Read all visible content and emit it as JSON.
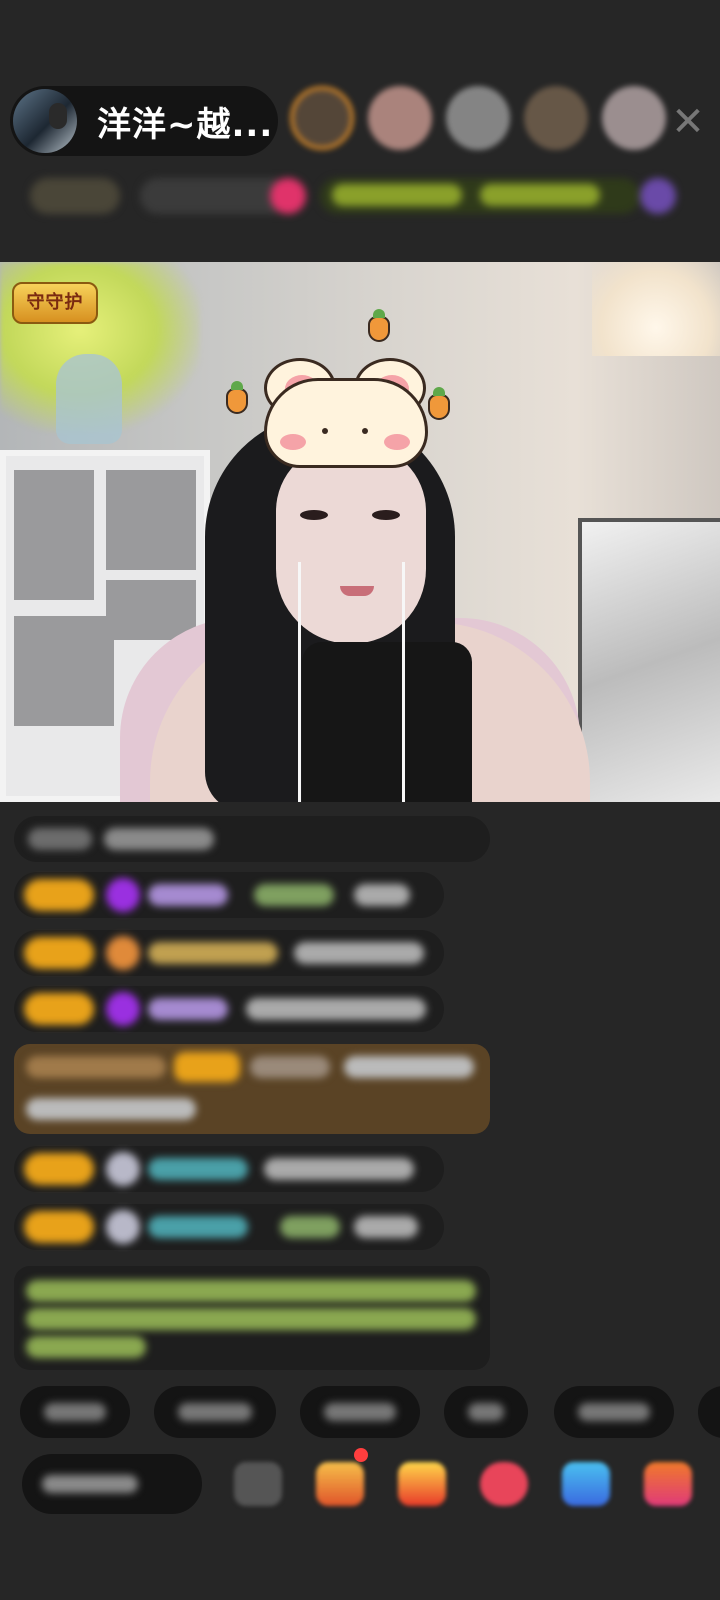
{
  "header": {
    "host_name": "洋洋~越..."
  },
  "video": {
    "guard_badge": "守守护"
  },
  "icons": {
    "close": "close-icon",
    "host_avatar": "host-avatar",
    "viewer_avatars": [
      "viewer-avatar",
      "viewer-avatar",
      "viewer-avatar",
      "viewer-avatar",
      "viewer-avatar"
    ]
  },
  "colors": {
    "background": "#262626",
    "pill": "#141414",
    "level_badge": "#e8a21a",
    "gold_message": "#5a4325"
  }
}
